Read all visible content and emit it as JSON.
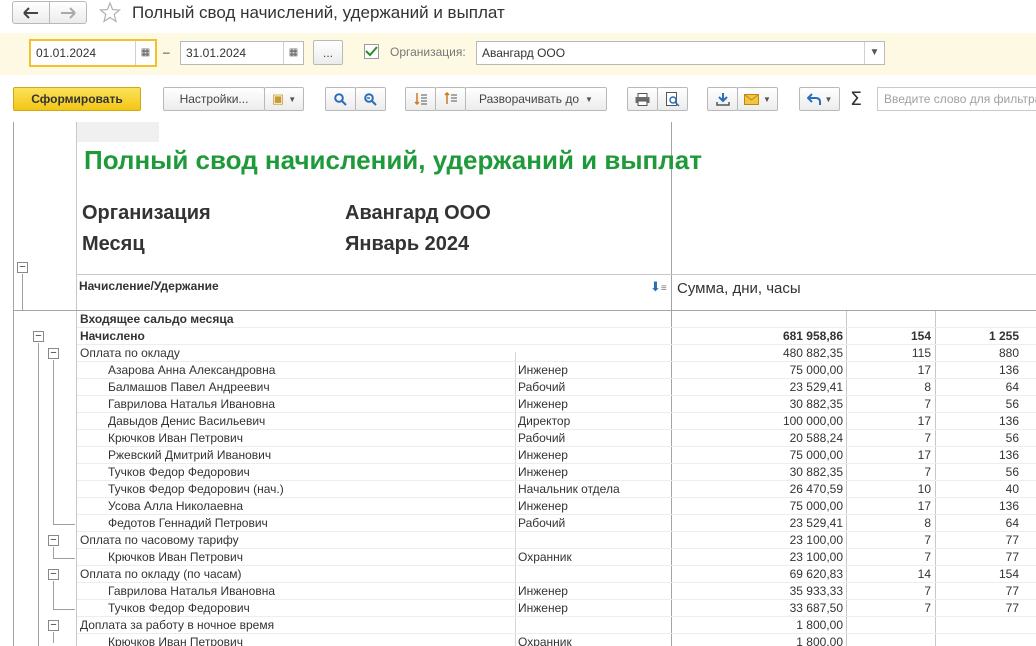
{
  "window": {
    "title": "Полный свод начислений, удержаний и выплат"
  },
  "filters": {
    "date_from": "01.01.2024",
    "date_sep": "–",
    "date_to": "31.01.2024",
    "more_label": "...",
    "org_checked": true,
    "org_label": "Организация:",
    "org_value": "Авангард ООО"
  },
  "toolbar": {
    "generate_label": "Сформировать",
    "settings_label": "Настройки...",
    "expand_label": "Разворачивать до",
    "search_placeholder": "Введите слово для фильтра"
  },
  "report": {
    "title": "Полный свод начислений, удержаний и выплат",
    "org_label": "Организация",
    "org_value": "Авангард ООО",
    "month_label": "Месяц",
    "month_value": "Январь 2024",
    "col_accrual": "Начисление/Удержание",
    "col_amount": "Сумма, дни, часы",
    "rows": [
      {
        "name": "Входящее сальдо месяца",
        "pos": "",
        "sum": "",
        "days": "",
        "hours": "",
        "bold": true,
        "level": 0
      },
      {
        "name": "Начислено",
        "pos": "",
        "sum": "681 958,86",
        "days": "154",
        "hours": "1 255",
        "bold": true,
        "level": 0
      },
      {
        "name": "Оплата по окладу",
        "pos": "",
        "sum": "480 882,35",
        "days": "115",
        "hours": "880",
        "bold": false,
        "level": 1
      },
      {
        "name": "Азарова Анна Александровна",
        "pos": "Инженер",
        "sum": "75 000,00",
        "days": "17",
        "hours": "136",
        "bold": false,
        "level": 2
      },
      {
        "name": "Балмашов Павел Андреевич",
        "pos": "Рабочий",
        "sum": "23 529,41",
        "days": "8",
        "hours": "64",
        "bold": false,
        "level": 2
      },
      {
        "name": "Гаврилова Наталья Ивановна",
        "pos": "Инженер",
        "sum": "30 882,35",
        "days": "7",
        "hours": "56",
        "bold": false,
        "level": 2
      },
      {
        "name": "Давыдов Денис Васильевич",
        "pos": "Директор",
        "sum": "100 000,00",
        "days": "17",
        "hours": "136",
        "bold": false,
        "level": 2
      },
      {
        "name": "Крючков Иван Петрович",
        "pos": "Рабочий",
        "sum": "20 588,24",
        "days": "7",
        "hours": "56",
        "bold": false,
        "level": 2
      },
      {
        "name": "Ржевский Дмитрий Иванович",
        "pos": "Инженер",
        "sum": "75 000,00",
        "days": "17",
        "hours": "136",
        "bold": false,
        "level": 2
      },
      {
        "name": "Тучков Федор Федорович",
        "pos": "Инженер",
        "sum": "30 882,35",
        "days": "7",
        "hours": "56",
        "bold": false,
        "level": 2
      },
      {
        "name": "Тучков Федор Федорович (нач.)",
        "pos": "Начальник отдела",
        "sum": "26 470,59",
        "days": "10",
        "hours": "40",
        "bold": false,
        "level": 2
      },
      {
        "name": "Усова Алла Николаевна",
        "pos": "Инженер",
        "sum": "75 000,00",
        "days": "17",
        "hours": "136",
        "bold": false,
        "level": 2
      },
      {
        "name": "Федотов Геннадий Петрович",
        "pos": "Рабочий",
        "sum": "23 529,41",
        "days": "8",
        "hours": "64",
        "bold": false,
        "level": 2
      },
      {
        "name": "Оплата по часовому тарифу",
        "pos": "",
        "sum": "23 100,00",
        "days": "7",
        "hours": "77",
        "bold": false,
        "level": 1
      },
      {
        "name": "Крючков Иван Петрович",
        "pos": "Охранник",
        "sum": "23 100,00",
        "days": "7",
        "hours": "77",
        "bold": false,
        "level": 2
      },
      {
        "name": "Оплата по окладу (по часам)",
        "pos": "",
        "sum": "69 620,83",
        "days": "14",
        "hours": "154",
        "bold": false,
        "level": 1
      },
      {
        "name": "Гаврилова Наталья Ивановна",
        "pos": "Инженер",
        "sum": "35 933,33",
        "days": "7",
        "hours": "77",
        "bold": false,
        "level": 2
      },
      {
        "name": "Тучков Федор Федорович",
        "pos": "Инженер",
        "sum": "33 687,50",
        "days": "7",
        "hours": "77",
        "bold": false,
        "level": 2
      },
      {
        "name": "Доплата за работу в ночное время",
        "pos": "",
        "sum": "1 800,00",
        "days": "",
        "hours": "",
        "bold": false,
        "level": 1
      },
      {
        "name": "Крючков Иван Петрович",
        "pos": "Охранник",
        "sum": "1 800,00",
        "days": "",
        "hours": "",
        "bold": false,
        "level": 2
      }
    ]
  },
  "colors": {
    "title_green": "#1f9a3a",
    "accent_yellow": "#f3c614",
    "filter_bg": "#fdf9e3"
  }
}
